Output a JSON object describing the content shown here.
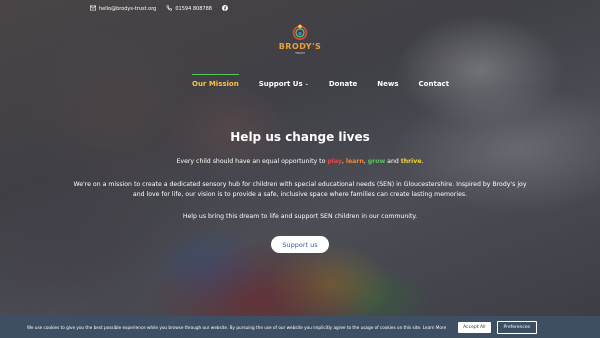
{
  "topbar": {
    "email": "hello@brodys-trust.org",
    "phone": "01594 808788"
  },
  "logo": {
    "text": "BRODY'S",
    "sub": "TRUST"
  },
  "nav": {
    "items": [
      {
        "label": "Our Mission"
      },
      {
        "label": "Support Us"
      },
      {
        "label": "Donate"
      },
      {
        "label": "News"
      },
      {
        "label": "Contact"
      }
    ]
  },
  "hero": {
    "title": "Help us change lives",
    "p1_prefix": "Every child should have an equal opportunity to ",
    "w_play": "play",
    "sep1": ", ",
    "w_learn": "learn",
    "sep2": ", ",
    "w_grow": "grow",
    "sep3": " and ",
    "w_thrive": "thrive",
    "p1_suffix": ".",
    "p2": "We're on a mission to create a dedicated sensory hub for children with special educational needs (SEN) in Gloucestershire. Inspired by Brody's joy and love for life, our vision is to provide a safe, inclusive space where families can create lasting memories.",
    "p3": "Help us bring this dream to life and support SEN children in our community.",
    "button": "Support us"
  },
  "cookie": {
    "text": "We use cookies to give you the best possible experience while you browse through our website. By pursuing the use of our website you implicitly agree to the usage of cookies on this site. Learn More",
    "accept": "Accept All",
    "prefs": "Preferences"
  },
  "colors": {
    "play": "#e64646",
    "learn": "#f08a2a",
    "grow": "#5bc45f",
    "thrive": "#f5d23a",
    "cookie_bg": "#3f4f63"
  }
}
